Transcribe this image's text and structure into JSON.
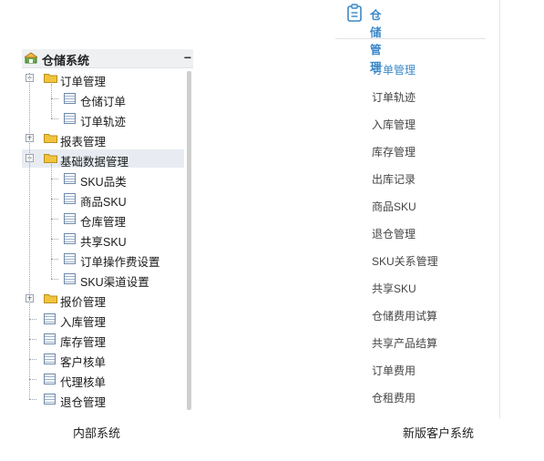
{
  "internal_system": {
    "root": {
      "title": "仓储系统",
      "collapse_symbol": "−"
    },
    "tree": [
      {
        "label": "订单管理",
        "type": "folder",
        "expanded": true,
        "children": [
          {
            "label": "仓储订单"
          },
          {
            "label": "订单轨迹"
          }
        ]
      },
      {
        "label": "报表管理",
        "type": "folder",
        "expanded": false
      },
      {
        "label": "基础数据管理",
        "type": "folder",
        "expanded": true,
        "highlighted": true,
        "children": [
          {
            "label": "SKU品类"
          },
          {
            "label": "商品SKU"
          },
          {
            "label": "仓库管理"
          },
          {
            "label": "共享SKU"
          },
          {
            "label": "订单操作费设置"
          },
          {
            "label": "SKU渠道设置"
          }
        ]
      },
      {
        "label": "报价管理",
        "type": "folder",
        "expanded": false
      },
      {
        "label": "入库管理",
        "type": "page"
      },
      {
        "label": "库存管理",
        "type": "page"
      },
      {
        "label": "客户核单",
        "type": "page"
      },
      {
        "label": "代理核单",
        "type": "page"
      },
      {
        "label": "退仓管理",
        "type": "page"
      }
    ],
    "caption": "内部系统",
    "icons": {
      "root": "warehouse-icon",
      "folder": "folder-icon",
      "page": "page-icon"
    }
  },
  "customer_system": {
    "header": {
      "title": "仓储管理",
      "icon": "clipboard-icon"
    },
    "menu": [
      {
        "label": "订单管理",
        "active": true
      },
      {
        "label": "订单轨迹"
      },
      {
        "label": "入库管理"
      },
      {
        "label": "库存管理"
      },
      {
        "label": "出库记录"
      },
      {
        "label": "商品SKU"
      },
      {
        "label": "退仓管理"
      },
      {
        "label": "SKU关系管理"
      },
      {
        "label": "共享SKU"
      },
      {
        "label": "仓储费用试算"
      },
      {
        "label": "共享产品结算"
      },
      {
        "label": "订单费用"
      },
      {
        "label": "仓租费用"
      }
    ],
    "caption": "新版客户系统"
  },
  "colors": {
    "accent": "#3a88c9",
    "folder": "#f2c33d",
    "highlight": "#e8ecf2"
  }
}
